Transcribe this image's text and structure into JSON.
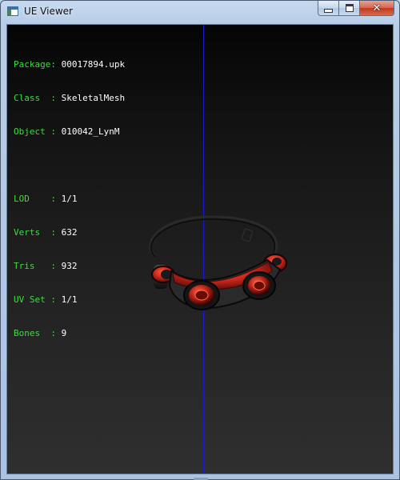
{
  "window": {
    "title": "UE Viewer",
    "icon": "app-icon",
    "buttons": [
      "minimize-icon",
      "maximize-icon",
      "close-icon"
    ]
  },
  "info": {
    "package": {
      "key": "Package:",
      "value": "00017894.upk"
    },
    "class": {
      "key": "Class  :",
      "value": "SkeletalMesh"
    },
    "object": {
      "key": "Object :",
      "value": "010042_LynM"
    },
    "lod": {
      "key": "LOD    :",
      "value": "1/1"
    },
    "verts": {
      "key": "Verts  :",
      "value": "632"
    },
    "tris": {
      "key": "Tris   :",
      "value": "932"
    },
    "uvset": {
      "key": "UV Set :",
      "value": "1/1"
    },
    "bones": {
      "key": "Bones  :",
      "value": "9"
    }
  },
  "colors": {
    "label": "#3edc3e",
    "value": "#ffffff",
    "axis": "#1a1ad8",
    "mesh_accent": "#c8261c"
  }
}
